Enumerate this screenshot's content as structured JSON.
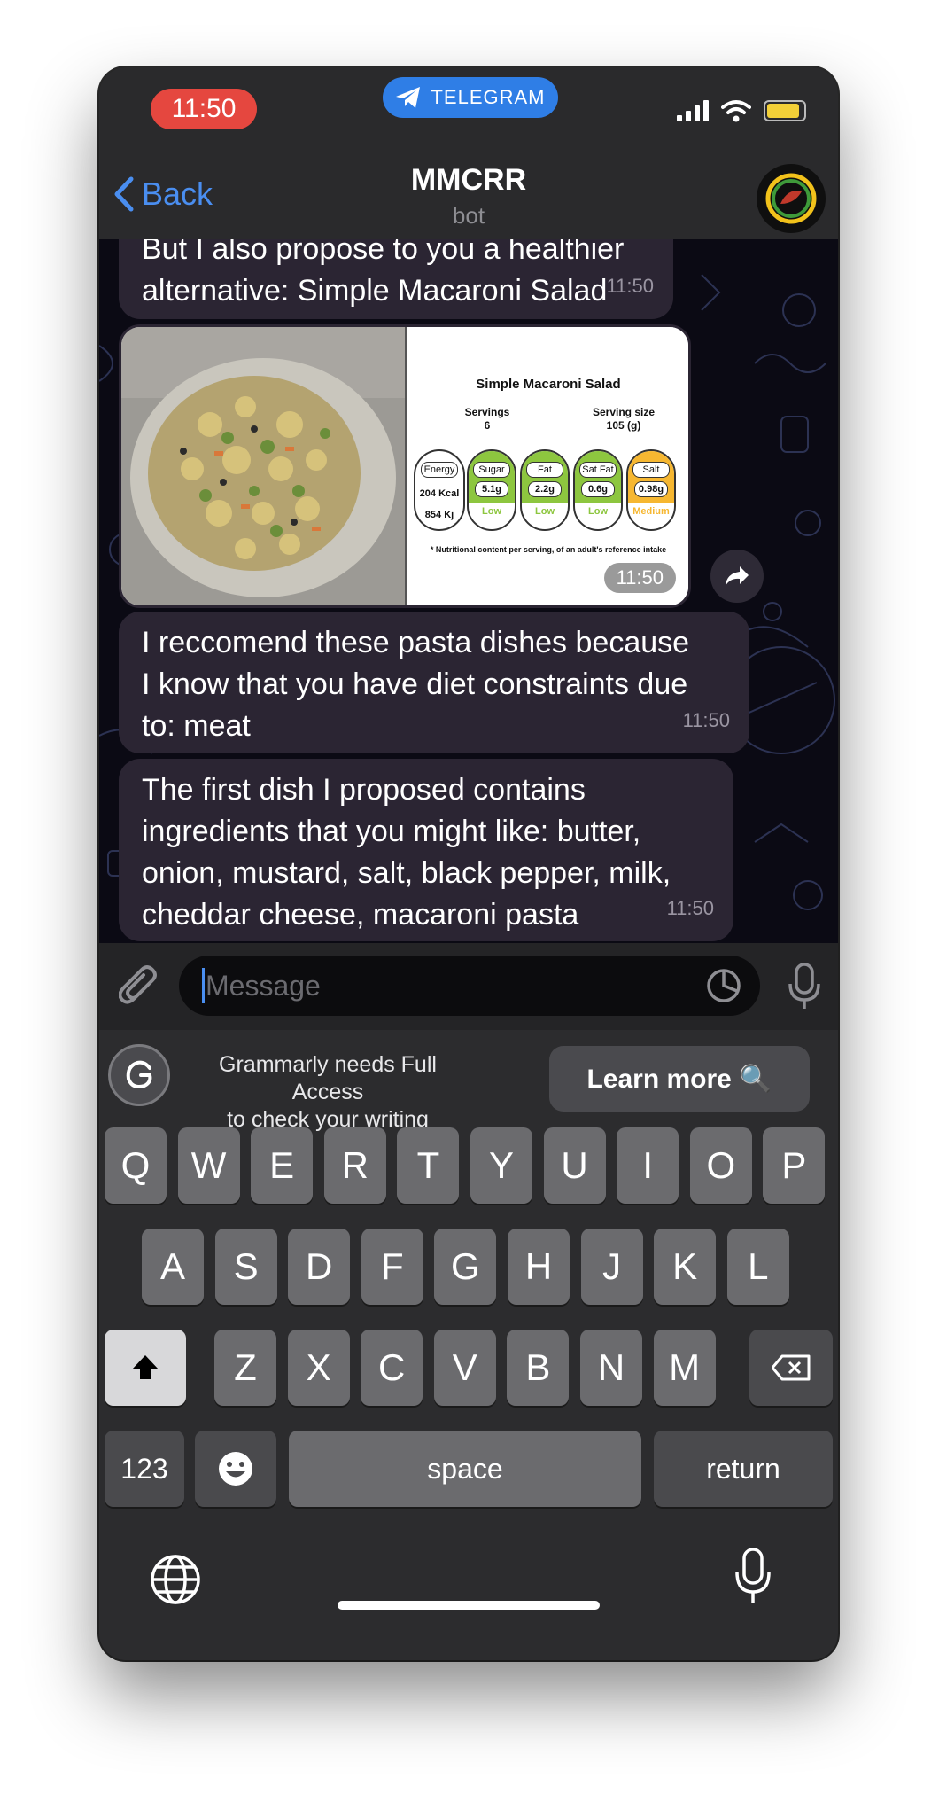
{
  "status": {
    "time": "11:50",
    "app_pill": "TELEGRAM"
  },
  "header": {
    "back_label": "Back",
    "title": "MMCRR",
    "subtitle": "bot"
  },
  "messages": [
    {
      "lines": [
        "But I also propose to you a healthier",
        "alternative: Simple Macaroni Salad"
      ],
      "time": "11:50"
    },
    {
      "type": "image",
      "time": "11:50"
    },
    {
      "lines": [
        "I reccomend these pasta dishes because",
        "I know that you have diet constraints due",
        "to: meat"
      ],
      "time": "11:50"
    },
    {
      "lines": [
        "The first dish I proposed contains",
        "ingredients that you might like: butter,",
        "onion, mustard, salt, black pepper, milk,",
        "cheddar cheese, macaroni pasta"
      ],
      "time": "11:50"
    }
  ],
  "nutrition_card": {
    "title": "Simple Macaroni Salad",
    "servings_label": "Servings",
    "servings_value": "6",
    "serving_size_label": "Serving size",
    "serving_size_value": "105 (g)",
    "energy_label": "Energy",
    "energy_kcal": "204 Kcal",
    "energy_kj": "854 Kj",
    "items": [
      {
        "label": "Sugar",
        "value": "5.1g",
        "level": "Low",
        "color": "#8dc63f"
      },
      {
        "label": "Fat",
        "value": "2.2g",
        "level": "Low",
        "color": "#8dc63f"
      },
      {
        "label": "Sat Fat",
        "value": "0.6g",
        "level": "Low",
        "color": "#8dc63f"
      },
      {
        "label": "Salt",
        "value": "0.98g",
        "level": "Medium",
        "color": "#f6b731"
      }
    ],
    "footnote": "* Nutritional content per serving, of an adult's reference intake"
  },
  "input": {
    "placeholder": "Message"
  },
  "grammarly": {
    "line1": "Grammarly needs Full Access",
    "line2": "to check your writing",
    "button": "Learn more 🔍"
  },
  "keyboard": {
    "row1": [
      "Q",
      "W",
      "E",
      "R",
      "T",
      "Y",
      "U",
      "I",
      "O",
      "P"
    ],
    "row2": [
      "A",
      "S",
      "D",
      "F",
      "G",
      "H",
      "J",
      "K",
      "L"
    ],
    "row3": [
      "Z",
      "X",
      "C",
      "V",
      "B",
      "N",
      "M"
    ],
    "numbers": "123",
    "space": "space",
    "return": "return"
  },
  "colors": {
    "accent": "#4a8ef0",
    "bubble": "#2b2533",
    "time_pill": "#e5473f",
    "telegram": "#2f7ee6"
  }
}
